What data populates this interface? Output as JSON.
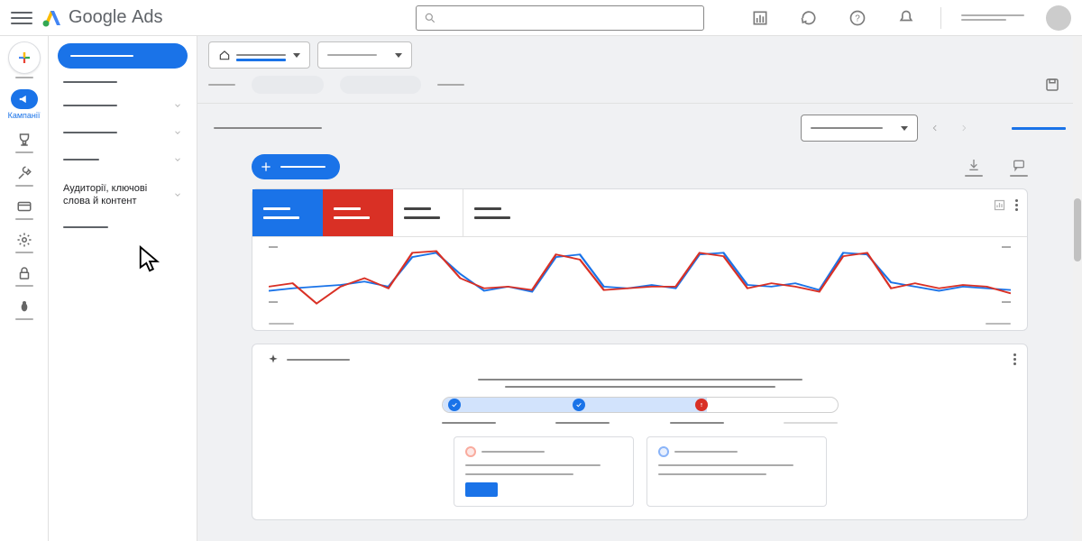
{
  "header": {
    "product_family": "Google",
    "product_name": "Ads"
  },
  "rail": {
    "campaigns_label": "Кампанії"
  },
  "sidebar": {
    "audiences_label": "Аудиторії, ключові слова й контент"
  },
  "chart_data": {
    "type": "line",
    "x": [
      0,
      1,
      2,
      3,
      4,
      5,
      6,
      7,
      8,
      9,
      10,
      11,
      12,
      13,
      14,
      15,
      16,
      17,
      18,
      19,
      20,
      21,
      22,
      23,
      24,
      25,
      26,
      27,
      28,
      29,
      30,
      31
    ],
    "series": [
      {
        "name": "metric-blue",
        "color": "#1a73e8",
        "values": [
          25,
          28,
          30,
          32,
          36,
          30,
          65,
          70,
          45,
          25,
          30,
          24,
          65,
          68,
          30,
          28,
          32,
          28,
          68,
          70,
          32,
          30,
          34,
          26,
          70,
          68,
          35,
          30,
          25,
          30,
          28,
          26
        ]
      },
      {
        "name": "metric-red",
        "color": "#d93025",
        "values": [
          30,
          34,
          10,
          30,
          40,
          28,
          70,
          72,
          40,
          28,
          30,
          26,
          68,
          62,
          26,
          28,
          30,
          30,
          70,
          66,
          28,
          34,
          30,
          24,
          66,
          70,
          28,
          34,
          28,
          32,
          30,
          22
        ]
      }
    ],
    "ylim": [
      0,
      80
    ]
  },
  "progress": {
    "percent": 67,
    "steps": [
      {
        "status": "ok"
      },
      {
        "status": "ok"
      },
      {
        "status": "error"
      }
    ]
  }
}
